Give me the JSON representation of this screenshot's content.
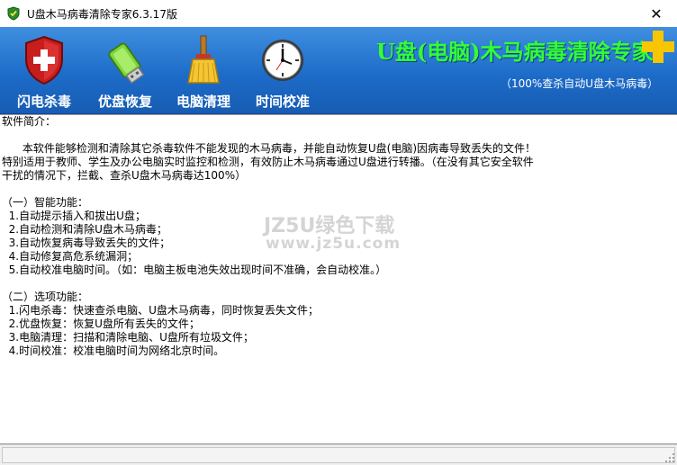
{
  "window": {
    "title": "U盘木马病毒清除专家6.3.17版",
    "close_glyph": "✕"
  },
  "toolbar": {
    "items": [
      {
        "label": "闪电杀毒",
        "icon": "shield-icon"
      },
      {
        "label": "优盘恢复",
        "icon": "usb-drive-icon"
      },
      {
        "label": "电脑清理",
        "icon": "broom-icon"
      },
      {
        "label": "时间校准",
        "icon": "clock-icon"
      }
    ]
  },
  "brand": {
    "title": "U盘(电脑)木马病毒清除专家",
    "subtitle": "（100%查杀自动U盘木马病毒）",
    "accent_color": "#33ff33",
    "plus_color": "#f7c600"
  },
  "content": {
    "text": "软件简介：\n\n      本软件能够检测和清除其它杀毒软件不能发现的木马病毒，并能自动恢复U盘(电脑)因病毒导致丢失的文件！\n特别适用于教师、学生及办公电脑实时监控和检测，有效防止木马病毒通过U盘进行转播。（在没有其它安全软件\n干扰的情况下，拦截、查杀U盘木马病毒达100%）\n\n（一）智能功能：\n  1.自动提示插入和拔出U盘；\n  2.自动检测和清除U盘木马病毒；\n  3.自动恢复病毒导致丢失的文件；\n  4.自动修复高危系统漏洞；\n  5.自动校准电脑时间。（如：电脑主板电池失效出现时间不准确，会自动校准。）\n\n（二）选项功能：\n  1.闪电杀毒：快速查杀电脑、U盘木马病毒，同时恢复丢失文件；\n  2.优盘恢复：恢复U盘所有丢失的文件；\n  3.电脑清理：扫描和清除电脑、U盘所有垃圾文件；\n  4.时间校准：校准电脑时间为网络北京时间。"
  },
  "watermark": {
    "line1": "JZ5U绿色下载",
    "line2": "www.jz5u.com"
  },
  "status": {
    "text": ""
  }
}
